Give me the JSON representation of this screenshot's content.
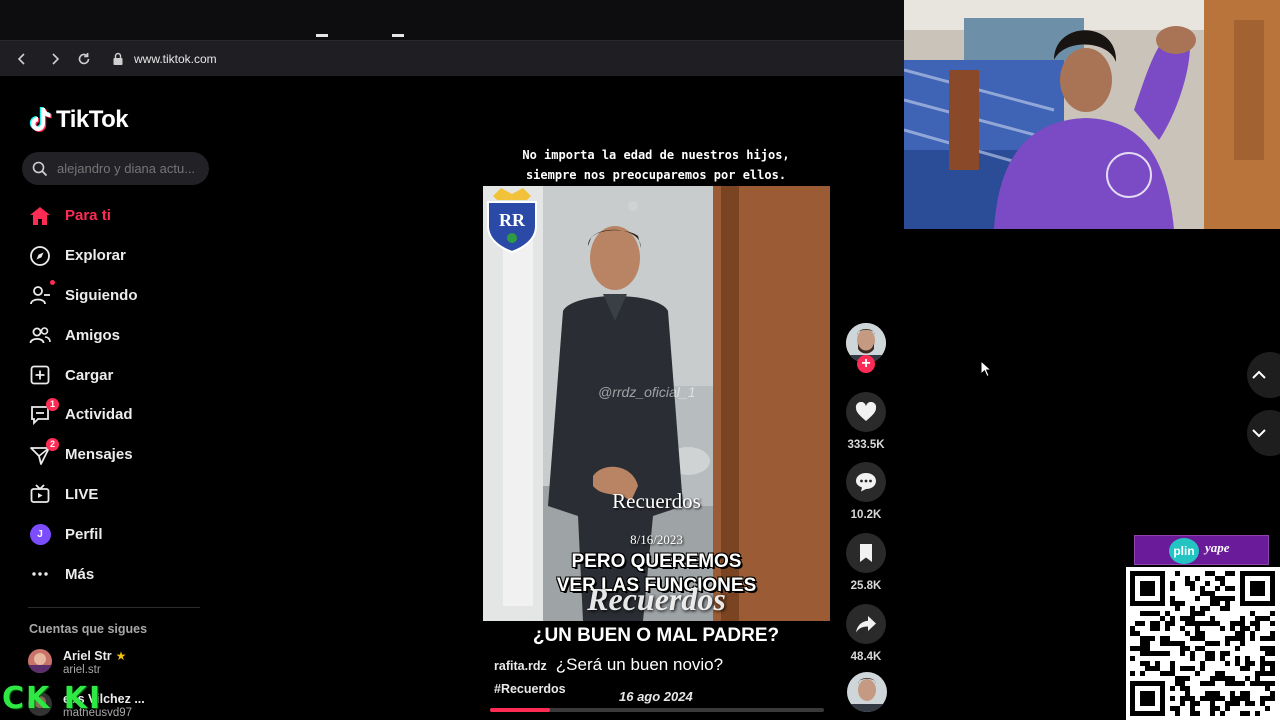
{
  "browser": {
    "url": "www.tiktok.com"
  },
  "app": {
    "name": "TikTok"
  },
  "search": {
    "placeholder": "alejandro y diana actu..."
  },
  "sidebar": {
    "items": [
      {
        "label": "Para ti",
        "icon": "home-icon",
        "active": true
      },
      {
        "label": "Explorar",
        "icon": "compass-icon"
      },
      {
        "label": "Siguiendo",
        "icon": "user-follow-icon"
      },
      {
        "label": "Amigos",
        "icon": "friends-icon"
      },
      {
        "label": "Cargar",
        "icon": "upload-icon"
      },
      {
        "label": "Actividad",
        "icon": "activity-icon",
        "badge": "1"
      },
      {
        "label": "Mensajes",
        "icon": "messages-icon",
        "badge": "2"
      },
      {
        "label": "LIVE",
        "icon": "live-icon"
      },
      {
        "label": "Perfil",
        "icon": "profile-avatar",
        "avatar_letter": "J"
      },
      {
        "label": "Más",
        "icon": "more-icon"
      }
    ],
    "following_title": "Cuentas que sigues",
    "following": [
      {
        "name": "Ariel Str",
        "handle": "ariel.str",
        "verified_star": true
      },
      {
        "name": "eus Vilchez ...",
        "handle": "matheusvd97"
      }
    ]
  },
  "video": {
    "top_caption_line1": "No importa la edad de nuestros hijos,",
    "top_caption_line2": "siempre nos preocuparemos por ellos.",
    "watermark": "@rrdz_oficial_1",
    "overlay_recuerdos": "Recuerdos",
    "overlay_date": "8/16/2023",
    "subtitle_line1": "PERO QUEREMOS",
    "subtitle_line2": "VER LAS FUNCIONES",
    "overlay_recuerdos_big": "Recuerdos",
    "title_below": "¿UN BUEN O MAL PADRE?",
    "author": "rafita.rdz",
    "description": "¿Será un buen novio?",
    "hashtag": "#Recuerdos",
    "post_date": "16 ago 2024",
    "progress": 0.18
  },
  "actions": {
    "likes": "333.5K",
    "comments": "10.2K",
    "saves": "25.8K",
    "shares": "48.4K"
  },
  "overlays": {
    "ckki_text": "CK KI",
    "plin_label": "plin",
    "yape_label": "yape"
  },
  "colors": {
    "accent": "#fe2c55",
    "background": "#000000"
  }
}
